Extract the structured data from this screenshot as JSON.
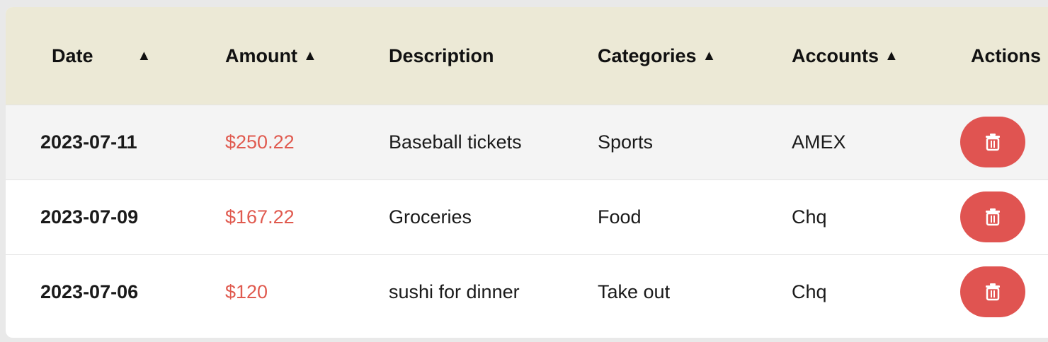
{
  "table": {
    "columns": [
      {
        "label": "Date",
        "sortable": true
      },
      {
        "label": "Amount",
        "sortable": true
      },
      {
        "label": "Description",
        "sortable": false
      },
      {
        "label": "Categories",
        "sortable": true
      },
      {
        "label": "Accounts",
        "sortable": true
      },
      {
        "label": "Actions",
        "sortable": false
      }
    ],
    "sort_glyph": "▲",
    "rows": [
      {
        "date": "2023-07-11",
        "amount": "$250.22",
        "description": "Baseball tickets",
        "category": "Sports",
        "account": "AMEX"
      },
      {
        "date": "2023-07-09",
        "amount": "$167.22",
        "description": "Groceries",
        "category": "Food",
        "account": "Chq"
      },
      {
        "date": "2023-07-06",
        "amount": "$120",
        "description": "sushi for dinner",
        "category": "Take out",
        "account": "Chq"
      }
    ],
    "delete_icon": "trash-icon"
  },
  "colors": {
    "header_bg": "#ece9d6",
    "amount_text": "#e05a4f",
    "delete_button": "#e05451",
    "alt_row_bg": "#f4f4f4"
  }
}
